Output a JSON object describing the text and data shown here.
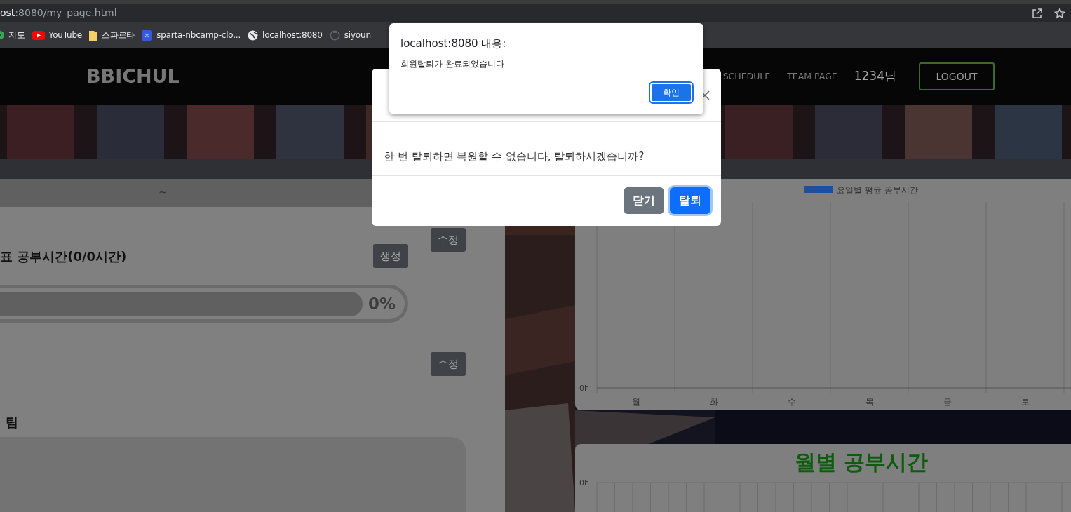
{
  "browser": {
    "url": {
      "host": "ost",
      "rest": ":8080/my_page.html"
    },
    "bookmarks": [
      {
        "label": "지도",
        "kind": "maps"
      },
      {
        "label": "YouTube",
        "kind": "youtube"
      },
      {
        "label": "스파르타",
        "kind": "folder"
      },
      {
        "label": "sparta-nbcamp-clo...",
        "kind": "site"
      },
      {
        "label": "localhost:8080",
        "kind": "globe"
      },
      {
        "label": "siyoun",
        "kind": "github"
      }
    ]
  },
  "navbar": {
    "brand": "BBICHUL",
    "links": [
      "SCHEDULE",
      "TEAM PAGE"
    ],
    "user": "1234님",
    "logout": "LOGOUT"
  },
  "date_bar": "~",
  "goal": {
    "edit": "수정",
    "title": "표 공부시간(0/0시간)",
    "create": "생성",
    "level": 0,
    "percent": "0%"
  },
  "second_edit": "수정",
  "team": {
    "heading": "팀"
  },
  "weekly_chart": {
    "legend": "요일별 평균 공부시간",
    "axis_label": "0h",
    "categories": [
      "월",
      "화",
      "수",
      "목",
      "금",
      "토"
    ]
  },
  "monthly_chart": {
    "title": "월별 공부시간",
    "axis_label": "0h"
  },
  "modal": {
    "body": "한 번 탈퇴하면 복원할 수 없습니다, 탈퇴하시겠습니까?",
    "buttons": [
      {
        "label": "닫기",
        "kind": "secondary",
        "focused": false
      },
      {
        "label": "탈퇴",
        "kind": "primary",
        "focused": true
      }
    ]
  },
  "alert": {
    "title": "localhost:8080 내용:",
    "message": "회원탈퇴가 완료되었습니다",
    "button": "확인"
  }
}
